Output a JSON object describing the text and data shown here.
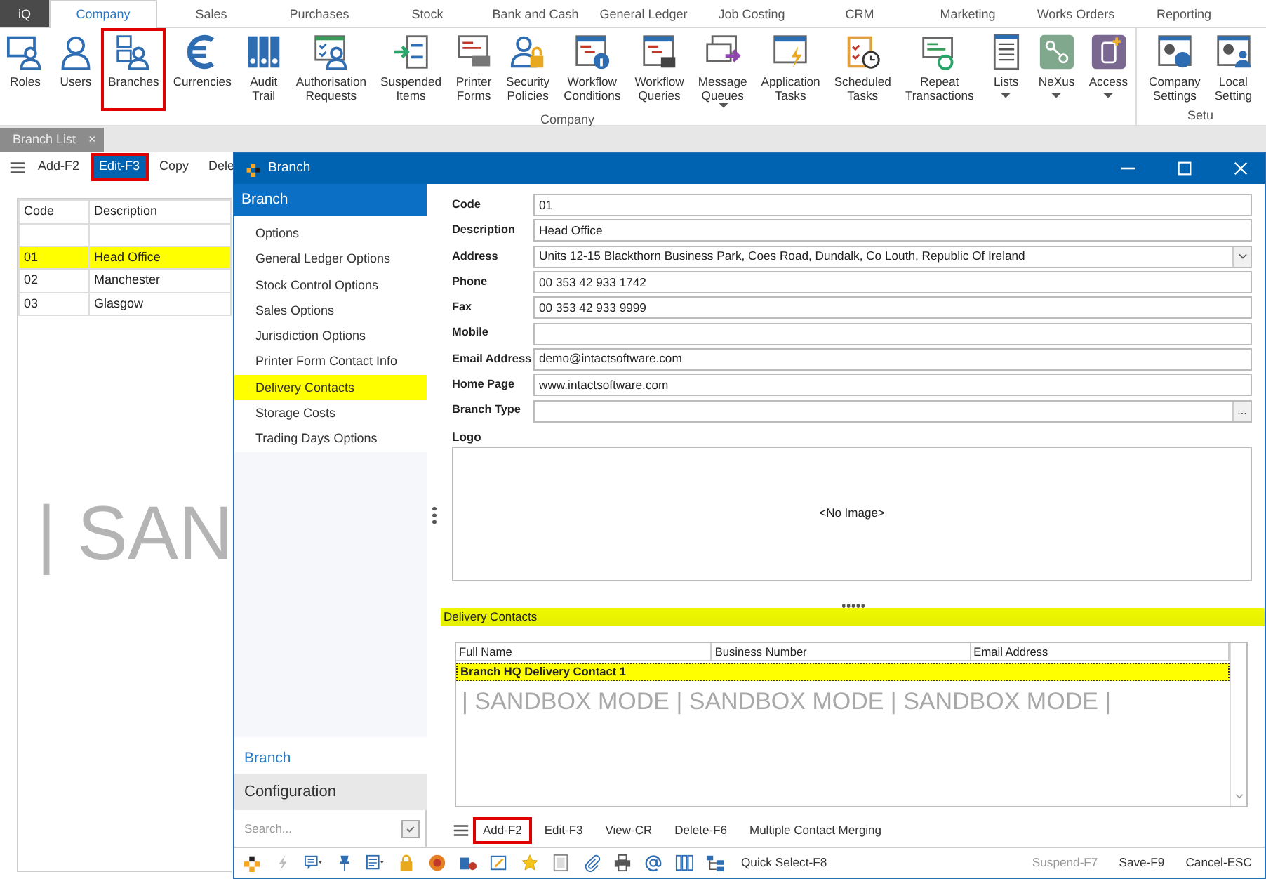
{
  "top_tabs": [
    {
      "label": "iQ",
      "selected": false,
      "kind": "app"
    },
    {
      "label": "Company",
      "selected": true,
      "kind": "tab"
    },
    {
      "label": "Sales",
      "selected": false,
      "kind": "tab"
    },
    {
      "label": "Purchases",
      "selected": false,
      "kind": "tab"
    },
    {
      "label": "Stock",
      "selected": false,
      "kind": "tab"
    },
    {
      "label": "Bank and Cash",
      "selected": false,
      "kind": "tab"
    },
    {
      "label": "General Ledger",
      "selected": false,
      "kind": "tab"
    },
    {
      "label": "Job Costing",
      "selected": false,
      "kind": "tab"
    },
    {
      "label": "CRM",
      "selected": false,
      "kind": "tab"
    },
    {
      "label": "Marketing",
      "selected": false,
      "kind": "tab"
    },
    {
      "label": "Works Orders",
      "selected": false,
      "kind": "tab"
    },
    {
      "label": "Reporting",
      "selected": false,
      "kind": "tab"
    }
  ],
  "ribbon": {
    "groups": [
      {
        "label": "Company",
        "items": [
          {
            "label": "Roles",
            "dropdown": false,
            "highlighted": false
          },
          {
            "label": "Users",
            "dropdown": false,
            "highlighted": false
          },
          {
            "label": "Branches",
            "dropdown": false,
            "highlighted": true
          },
          {
            "label": "Currencies",
            "dropdown": false,
            "highlighted": false
          },
          {
            "label": "Audit\nTrail",
            "dropdown": false,
            "highlighted": false
          },
          {
            "label": "Authorisation\nRequests",
            "dropdown": false,
            "highlighted": false
          },
          {
            "label": "Suspended\nItems",
            "dropdown": false,
            "highlighted": false
          },
          {
            "label": "Printer\nForms",
            "dropdown": false,
            "highlighted": false
          },
          {
            "label": "Security\nPolicies",
            "dropdown": false,
            "highlighted": false
          },
          {
            "label": "Workflow\nConditions",
            "dropdown": false,
            "highlighted": false
          },
          {
            "label": "Workflow\nQueries",
            "dropdown": false,
            "highlighted": false
          },
          {
            "label": "Message\nQueues",
            "dropdown": true,
            "highlighted": false
          },
          {
            "label": "Application\nTasks",
            "dropdown": false,
            "highlighted": false
          },
          {
            "label": "Scheduled\nTasks",
            "dropdown": false,
            "highlighted": false
          },
          {
            "label": "Repeat\nTransactions",
            "dropdown": false,
            "highlighted": false
          },
          {
            "label": "Lists",
            "dropdown": true,
            "highlighted": false
          },
          {
            "label": "NeXus",
            "dropdown": true,
            "highlighted": false
          },
          {
            "label": "Access",
            "dropdown": true,
            "highlighted": false
          }
        ]
      },
      {
        "label": "Setu",
        "items": [
          {
            "label": "Company\nSettings",
            "dropdown": false,
            "highlighted": false
          },
          {
            "label": "Local\nSetting",
            "dropdown": false,
            "highlighted": false
          }
        ]
      }
    ]
  },
  "document_tab": {
    "label": "Branch List",
    "close": "×"
  },
  "list_toolbar": [
    {
      "label": "Add-F2",
      "selected": false,
      "highlighted": false
    },
    {
      "label": "Edit-F3",
      "selected": true,
      "highlighted": true
    },
    {
      "label": "Copy",
      "selected": false,
      "highlighted": false
    },
    {
      "label": "Dele",
      "selected": false,
      "highlighted": false
    }
  ],
  "branch_grid": {
    "columns": [
      "Code",
      "Description"
    ],
    "rows": [
      {
        "code": "01",
        "description": "Head Office",
        "selected": true
      },
      {
        "code": "02",
        "description": "Manchester",
        "selected": false
      },
      {
        "code": "03",
        "description": "Glasgow",
        "selected": false
      }
    ]
  },
  "list_watermark": "| SAN",
  "dialog": {
    "title": "Branch",
    "nav": {
      "header": "Branch",
      "items": [
        {
          "label": "Options",
          "selected": false
        },
        {
          "label": "General Ledger Options",
          "selected": false
        },
        {
          "label": "Stock Control Options",
          "selected": false
        },
        {
          "label": "Sales Options",
          "selected": false
        },
        {
          "label": "Jurisdiction Options",
          "selected": false
        },
        {
          "label": "Printer Form Contact Info",
          "selected": false
        },
        {
          "label": "Delivery Contacts",
          "selected": true
        },
        {
          "label": "Storage Costs",
          "selected": false
        },
        {
          "label": "Trading Days Options",
          "selected": false
        }
      ],
      "footer_link": "Branch",
      "section": "Configuration",
      "search": {
        "placeholder": "Search...",
        "checked": true
      }
    },
    "form": {
      "fields": [
        {
          "label": "Code",
          "value": "01",
          "kind": "text"
        },
        {
          "label": "Description",
          "value": "Head Office",
          "kind": "text"
        },
        {
          "label": "Address",
          "value": "Units 12-15 Blackthorn Business Park, Coes Road, Dundalk, Co Louth, Republic Of Ireland",
          "kind": "dropdown"
        },
        {
          "label": "Phone",
          "value": "00 353 42 933 1742",
          "kind": "text"
        },
        {
          "label": "Fax",
          "value": "00 353 42 933 9999",
          "kind": "text"
        },
        {
          "label": "Mobile",
          "kind": "text"
        },
        {
          "label": "Email Address",
          "value": "demo@intactsoftware.com",
          "kind": "text"
        },
        {
          "label": "Home Page",
          "value": "www.intactsoftware.com",
          "kind": "text"
        },
        {
          "label": "Branch Type",
          "kind": "lookup",
          "button": "..."
        }
      ],
      "logo": {
        "label": "Logo",
        "placeholder": "<No Image>"
      }
    },
    "delivery_contacts": {
      "title": "Delivery Contacts",
      "columns": [
        "Full Name",
        "Business Number",
        "Email Address"
      ],
      "rows": [
        {
          "full_name": "Branch HQ Delivery Contact 1",
          "selected": true
        }
      ],
      "watermark": "| SANDBOX MODE | SANDBOX MODE | SANDBOX MODE |",
      "toolbar": [
        {
          "label": "Add-F2",
          "highlighted": true
        },
        {
          "label": "Edit-F3",
          "highlighted": false
        },
        {
          "label": "View-CR",
          "highlighted": false
        },
        {
          "label": "Delete-F6",
          "highlighted": false
        },
        {
          "label": "Multiple Contact Merging",
          "highlighted": false
        }
      ]
    },
    "status_bar": {
      "quick_select": "Quick Select-F8",
      "actions": [
        {
          "label": "Suspend-F7",
          "disabled": true
        },
        {
          "label": "Save-F9",
          "disabled": false
        },
        {
          "label": "Cancel-ESC",
          "disabled": false
        }
      ]
    }
  }
}
